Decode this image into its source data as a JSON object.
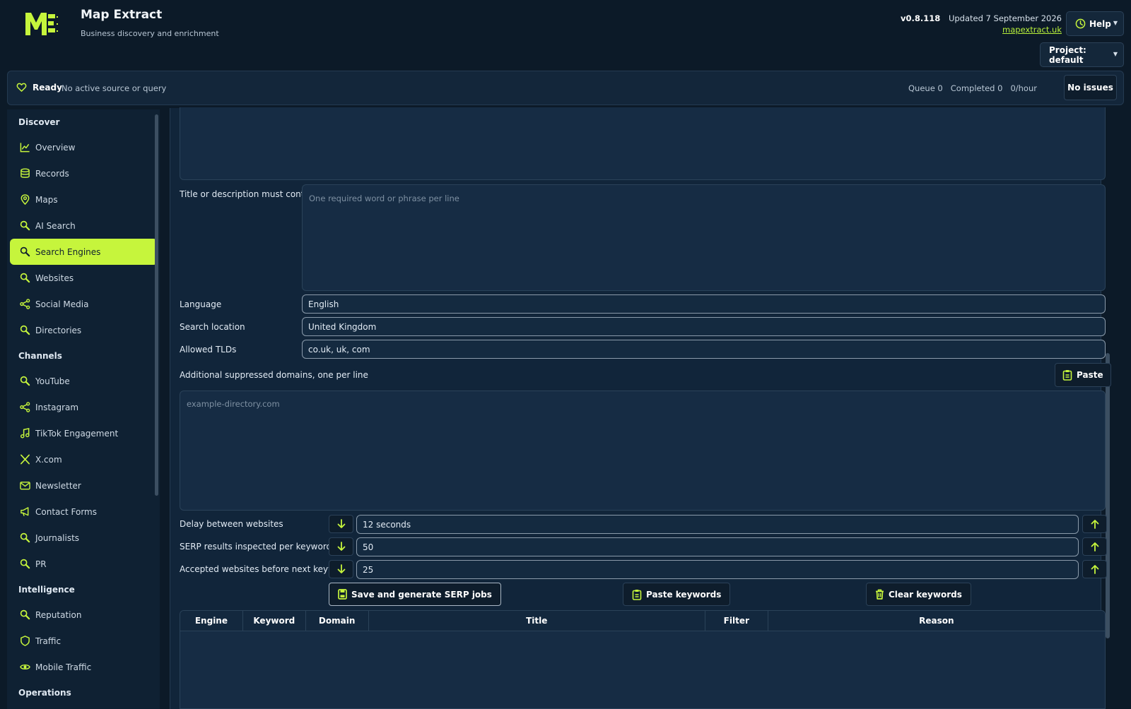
{
  "app": {
    "title": "Map Extract",
    "subtitle": "Business discovery and enrichment",
    "version": "v0.8.118",
    "updated": "Updated 7 September 2026",
    "site_link": "mapextract.uk",
    "help_label": "Help",
    "project_label": "Project: default"
  },
  "colors": {
    "accent": "#c6f53c",
    "background": "#0c1a28",
    "panel": "#11253a"
  },
  "status": {
    "state": "Ready",
    "message": "No active source or query",
    "queue": "Queue 0",
    "completed": "Completed 0",
    "rate": "0/hour",
    "issues_label": "No issues"
  },
  "sidebar": {
    "sections": [
      {
        "title": "Discover",
        "items": [
          {
            "label": "Overview",
            "icon": "chart-line-icon"
          },
          {
            "label": "Records",
            "icon": "database-icon"
          },
          {
            "label": "Maps",
            "icon": "map-pin-icon"
          },
          {
            "label": "AI Search",
            "icon": "search-icon"
          },
          {
            "label": "Search Engines",
            "icon": "search-icon",
            "active": true
          },
          {
            "label": "Websites",
            "icon": "search-icon"
          },
          {
            "label": "Social Media",
            "icon": "share-icon"
          },
          {
            "label": "Directories",
            "icon": "search-icon"
          }
        ]
      },
      {
        "title": "Channels",
        "items": [
          {
            "label": "YouTube",
            "icon": "search-icon"
          },
          {
            "label": "Instagram",
            "icon": "share-icon"
          },
          {
            "label": "TikTok Engagement",
            "icon": "music-note-icon"
          },
          {
            "label": "X.com",
            "icon": "x-logo-icon"
          },
          {
            "label": "Newsletter",
            "icon": "mail-icon"
          },
          {
            "label": "Contact Forms",
            "icon": "megaphone-icon"
          },
          {
            "label": "Journalists",
            "icon": "search-icon"
          },
          {
            "label": "PR",
            "icon": "search-icon"
          }
        ]
      },
      {
        "title": "Intelligence",
        "items": [
          {
            "label": "Reputation",
            "icon": "search-icon"
          },
          {
            "label": "Traffic",
            "icon": "shield-icon"
          },
          {
            "label": "Mobile Traffic",
            "icon": "eye-icon"
          }
        ]
      },
      {
        "title": "Operations",
        "items": []
      }
    ]
  },
  "form": {
    "title_filter_label": "Title or description must contain",
    "title_filter_placeholder": "One required word or phrase per line",
    "language_label": "Language",
    "language_value": "English",
    "location_label": "Search location",
    "location_value": "United Kingdom",
    "tlds_label": "Allowed TLDs",
    "tlds_value": "co.uk, uk, com",
    "suppressed_label": "Additional suppressed domains, one per line",
    "suppressed_placeholder": "example-directory.com",
    "paste_label": "Paste",
    "delay_label": "Delay between websites",
    "delay_value": "12 seconds",
    "serp_label": "SERP results inspected per keyword",
    "serp_value": "50",
    "accepted_label": "Accepted websites before next keyword",
    "accepted_value": "25",
    "save_label": "Save and generate SERP jobs",
    "paste_keywords_label": "Paste keywords",
    "clear_keywords_label": "Clear keywords"
  },
  "results_table": {
    "columns": [
      "Engine",
      "Keyword",
      "Domain",
      "Title",
      "Filter",
      "Reason"
    ]
  }
}
